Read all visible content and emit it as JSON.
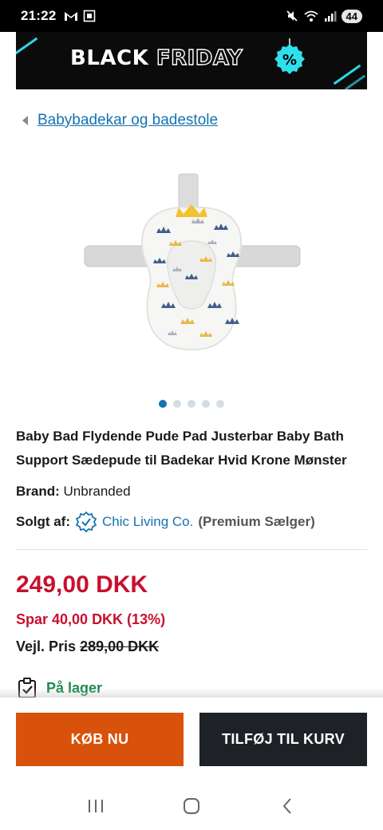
{
  "status_bar": {
    "time": "21:22",
    "battery": "44",
    "icons": [
      "gmail-icon",
      "screenshot-icon",
      "mute-icon",
      "wifi-icon",
      "signal-icon"
    ]
  },
  "banner": {
    "word1": "BLACK",
    "word2": "FRIDAY",
    "badge": "%"
  },
  "breadcrumb": {
    "label": "Babybadekar og badestole"
  },
  "carousel": {
    "count": 5,
    "active": 0
  },
  "product": {
    "title": "Baby Bad Flydende Pude Pad Justerbar Baby Bath Support Sædepude til Badekar Hvid Krone Mønster",
    "brand_label": "Brand:",
    "brand": "Unbranded",
    "seller_label": "Solgt af:",
    "seller": "Chic Living Co.",
    "seller_tier": "(Premium Sælger)"
  },
  "pricing": {
    "price": "249,00 DKK",
    "savings": "Spar 40,00 DKK (13%)",
    "rrp_label": "Vejl. Pris",
    "rrp": "289,00 DKK"
  },
  "stock": {
    "label": "På lager"
  },
  "actions": {
    "buy_now": "KØB NU",
    "add_to_cart": "TILFØJ TIL KURV"
  },
  "colors": {
    "accent_blue": "#1473b0",
    "price_red": "#c8102e",
    "buy_orange": "#d9520b",
    "cart_dark": "#1e2227",
    "stock_green": "#1a8a4a"
  }
}
